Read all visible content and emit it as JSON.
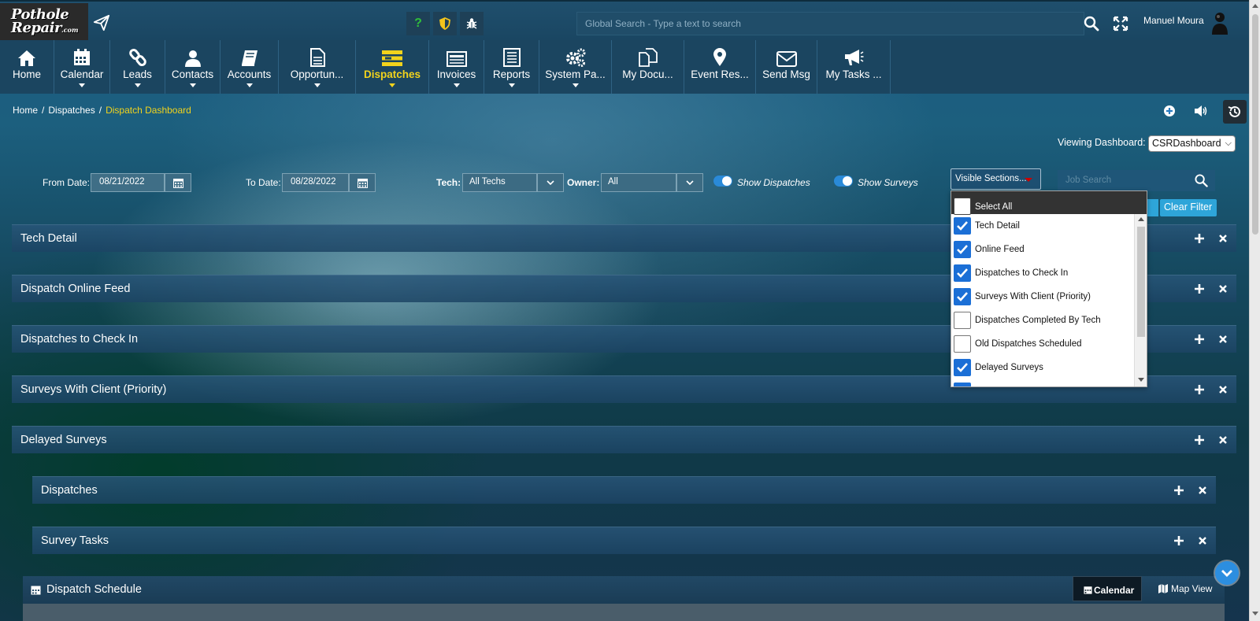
{
  "app": {
    "logo_line1": "Pothole",
    "logo_line2": "Repair",
    "logo_suffix": ".com"
  },
  "topbar": {
    "help_icon": "?",
    "search_placeholder": "Global Search - Type a text to search",
    "user_name": "Manuel Moura"
  },
  "nav": {
    "items": [
      {
        "label": "Home",
        "icon": "home-icon"
      },
      {
        "label": "Calendar",
        "icon": "calendar-icon"
      },
      {
        "label": "Leads",
        "icon": "link-icon"
      },
      {
        "label": "Contacts",
        "icon": "user-icon"
      },
      {
        "label": "Accounts",
        "icon": "book-icon"
      },
      {
        "label": "Opportun...",
        "icon": "document-icon"
      },
      {
        "label": "Dispatches",
        "icon": "dispatch-icon"
      },
      {
        "label": "Invoices",
        "icon": "invoice-icon"
      },
      {
        "label": "Reports",
        "icon": "report-icon"
      },
      {
        "label": "System Pa...",
        "icon": "gears-icon"
      },
      {
        "label": "My Docu...",
        "icon": "documents-icon"
      },
      {
        "label": "Event Res...",
        "icon": "map-pin-icon"
      },
      {
        "label": "Send Msg",
        "icon": "envelope-icon"
      },
      {
        "label": "My Tasks ...",
        "icon": "megaphone-icon"
      }
    ],
    "active": "Dispatches"
  },
  "breadcrumb": {
    "home": "Home",
    "section": "Dispatches",
    "current": "Dispatch Dashboard"
  },
  "viewing": {
    "label": "Viewing Dashboard:",
    "value": "CSRDashboard"
  },
  "filters": {
    "from_label": "From Date:",
    "from_value": "08/21/2022",
    "to_label": "To Date:",
    "to_value": "08/28/2022",
    "tech_label": "Tech:",
    "tech_value": "All Techs",
    "owner_label": "Owner:",
    "owner_value": "All",
    "show_dispatches": "Show Dispatches",
    "show_surveys": "Show Surveys",
    "visible_sections": "Visible Sections...",
    "job_search_placeholder": "Job Search",
    "clear_filter": "Clear Filter"
  },
  "sections": [
    {
      "title": "Tech Detail"
    },
    {
      "title": "Dispatch Online Feed"
    },
    {
      "title": "Dispatches to Check In"
    },
    {
      "title": "Surveys With Client (Priority)"
    },
    {
      "title": "Delayed Surveys"
    },
    {
      "title": "Dispatches"
    },
    {
      "title": "Survey Tasks"
    }
  ],
  "schedule": {
    "title": "Dispatch Schedule",
    "tab_calendar": "Calendar",
    "tab_map": "Map View"
  },
  "dropdown": {
    "select_all": "Select All",
    "options": [
      {
        "label": "Tech Detail",
        "checked": true
      },
      {
        "label": "Online Feed",
        "checked": true
      },
      {
        "label": "Dispatches to Check In",
        "checked": true
      },
      {
        "label": "Surveys With Client (Priority)",
        "checked": true
      },
      {
        "label": "Dispatches Completed By Tech",
        "checked": false
      },
      {
        "label": "Old Dispatches Scheduled",
        "checked": false
      },
      {
        "label": "Delayed Surveys",
        "checked": true
      }
    ]
  },
  "colors": {
    "accent_yellow": "#f2d31c",
    "checkbox_blue": "#1b6fd6",
    "clear_filter": "#2ea5d9"
  }
}
